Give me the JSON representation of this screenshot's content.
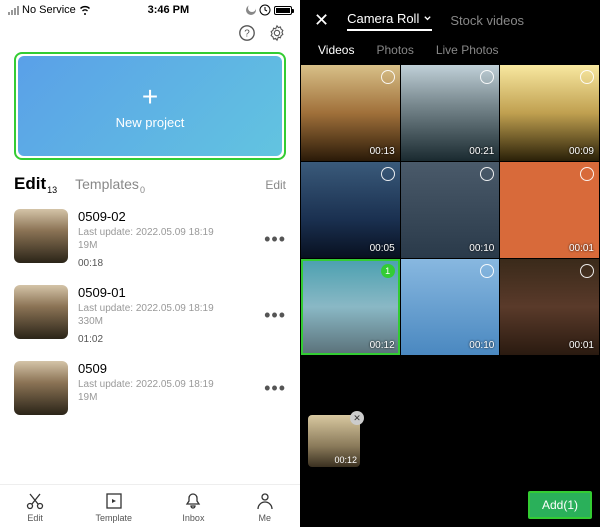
{
  "status": {
    "carrier": "No Service",
    "time": "3:46 PM"
  },
  "newproject": {
    "label": "New project"
  },
  "tabs": {
    "edit": "Edit",
    "edit_count": "13",
    "templates": "Templates",
    "templates_count": "0",
    "edit_action": "Edit"
  },
  "projects": [
    {
      "title": "0509-02",
      "updated": "Last update: 2022.05.09 18:19",
      "size": "19M",
      "duration": "00:18"
    },
    {
      "title": "0509-01",
      "updated": "Last update: 2022.05.09 18:19",
      "size": "330M",
      "duration": "01:02"
    },
    {
      "title": "0509",
      "updated": "Last update: 2022.05.09 18:19",
      "size": "19M",
      "duration": ""
    }
  ],
  "bottomtabs": {
    "edit": "Edit",
    "template": "Template",
    "inbox": "Inbox",
    "me": "Me"
  },
  "picker": {
    "source": "Camera Roll",
    "source2": "Stock videos",
    "tabs": {
      "videos": "Videos",
      "photos": "Photos",
      "live": "Live Photos"
    },
    "clips": [
      {
        "dur": "00:13",
        "cls": "c1"
      },
      {
        "dur": "00:21",
        "cls": "c2"
      },
      {
        "dur": "00:09",
        "cls": "c3"
      },
      {
        "dur": "00:05",
        "cls": "c4"
      },
      {
        "dur": "00:10",
        "cls": "c5"
      },
      {
        "dur": "00:01",
        "cls": "c6"
      },
      {
        "dur": "00:12",
        "cls": "c7",
        "selected": true,
        "badge": "1"
      },
      {
        "dur": "00:10",
        "cls": "c8"
      },
      {
        "dur": "00:01",
        "cls": "c9"
      }
    ],
    "tray": {
      "dur": "00:12"
    },
    "add": "Add(1)"
  }
}
